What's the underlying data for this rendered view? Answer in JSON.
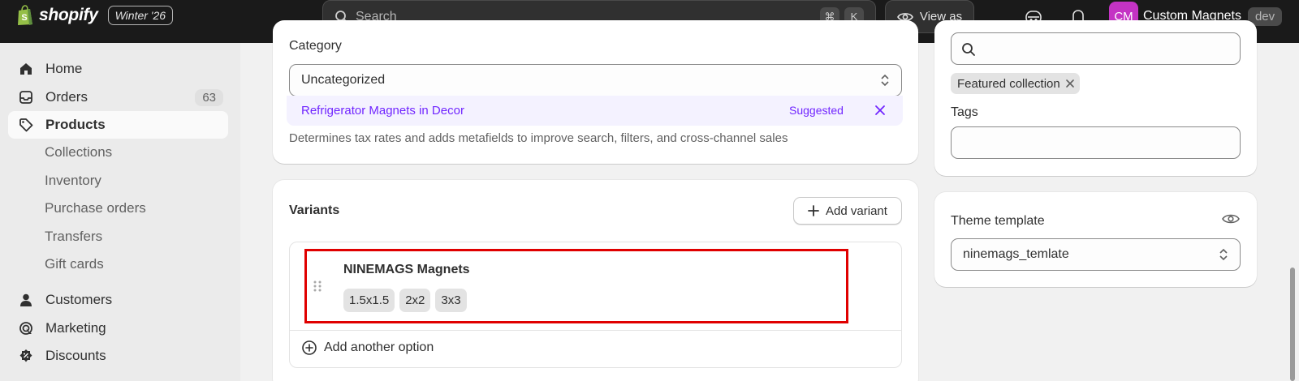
{
  "topbar": {
    "brand": "shopify",
    "edition_badge": "Winter '26",
    "search_placeholder": "Search",
    "shortcut_keys": [
      "⌘",
      "K"
    ],
    "view_as_label": "View as",
    "store_initials": "CM",
    "store_name": "Custom Magnets",
    "store_env": "dev"
  },
  "sidebar": {
    "items": [
      {
        "label": "Home",
        "icon": "home-icon"
      },
      {
        "label": "Orders",
        "icon": "inbox-icon",
        "count": "63"
      },
      {
        "label": "Products",
        "icon": "tag-icon",
        "active": true
      }
    ],
    "product_subitems": [
      "Collections",
      "Inventory",
      "Purchase orders",
      "Transfers",
      "Gift cards"
    ],
    "bottom_items": [
      {
        "label": "Customers",
        "icon": "person-icon"
      },
      {
        "label": "Marketing",
        "icon": "target-icon"
      },
      {
        "label": "Discounts",
        "icon": "discount-icon"
      }
    ]
  },
  "category": {
    "label": "Category",
    "value": "Uncategorized",
    "suggestion_name": "Refrigerator Magnets",
    "suggestion_in": "in Decor",
    "suggested_badge": "Suggested",
    "help_text": "Determines tax rates and adds metafields to improve search, filters, and cross-channel sales"
  },
  "variants": {
    "title": "Variants",
    "add_variant_label": "Add variant",
    "option_name": "NINEMAGS Magnets",
    "option_values": [
      "1.5x1.5",
      "2x2",
      "3x3"
    ],
    "add_option_label": "Add another option"
  },
  "organization": {
    "collection_chip": "Featured collection",
    "tags_label": "Tags",
    "tags_value": ""
  },
  "theme": {
    "label": "Theme template",
    "value": "ninemags_temlate"
  },
  "colors": {
    "topbar": "#1a1a1a",
    "suggestion": "#7126ff",
    "avatar": "#c433c4",
    "highlight": "#e00000"
  }
}
